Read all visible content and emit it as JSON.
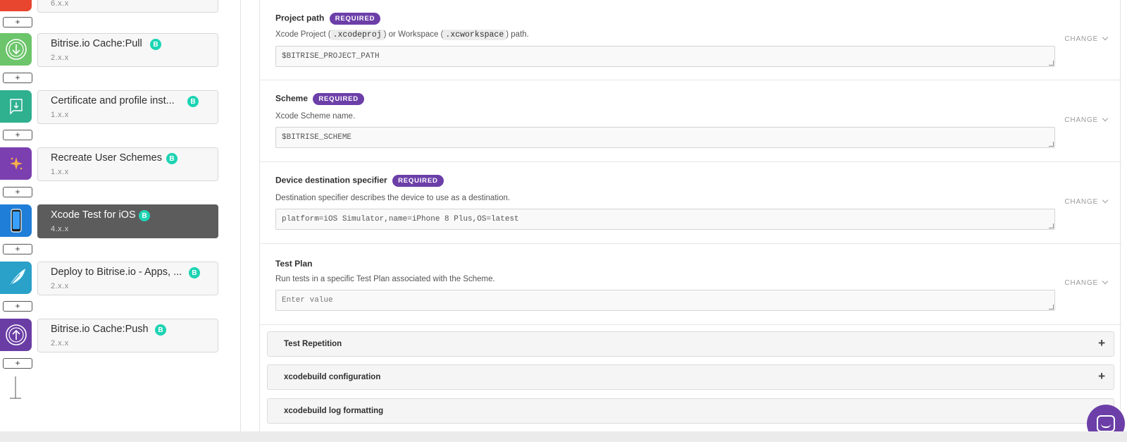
{
  "steps": [
    {
      "title": "Bitrise.io Cache:Pull",
      "version": "2.x.x",
      "icon": "download-circle-icon",
      "color": "#6cc56a"
    },
    {
      "title": "Certificate and profile inst...",
      "version": "1.x.x",
      "icon": "certificate-download-icon",
      "color": "#2fb08f"
    },
    {
      "title": "Recreate User Schemes",
      "version": "1.x.x",
      "icon": "sparkle-icon",
      "color": "#7b3fb0"
    },
    {
      "title": "Xcode Test for iOS",
      "version": "4.x.x",
      "icon": "iphone-icon",
      "color": "#1f7fd8"
    },
    {
      "title": "Deploy to Bitrise.io - Apps, ...",
      "version": "2.x.x",
      "icon": "feather-icon",
      "color": "#2aa1c9"
    },
    {
      "title": "Bitrise.io Cache:Push",
      "version": "2.x.x",
      "icon": "upload-circle-icon",
      "color": "#6a3da5"
    }
  ],
  "top_partial_step": {
    "version": "6.x.x",
    "icon_color": "#e8462e"
  },
  "badge_letter": "B",
  "plus_label": "+",
  "inputs": [
    {
      "title": "Project path",
      "required": "REQUIRED",
      "desc_pre": "Xcode Project (",
      "desc_code1": ".xcodeproj",
      "desc_mid": ") or Workspace (",
      "desc_code2": ".xcworkspace",
      "desc_post": ") path.",
      "value": "$BITRISE_PROJECT_PATH",
      "change": "CHANGE"
    },
    {
      "title": "Scheme",
      "required": "REQUIRED",
      "desc": "Xcode Scheme name.",
      "value": "$BITRISE_SCHEME",
      "change": "CHANGE"
    },
    {
      "title": "Device destination specifier",
      "required": "REQUIRED",
      "desc": "Destination specifier describes the device to use as a destination.",
      "value": "platform=iOS Simulator,name=iPhone 8 Plus,OS=latest",
      "change": "CHANGE"
    },
    {
      "title": "Test Plan",
      "desc": "Run tests in a specific Test Plan associated with the Scheme.",
      "placeholder": "Enter value",
      "change": "CHANGE"
    }
  ],
  "collapsibles": [
    {
      "label": "Test Repetition"
    },
    {
      "label": "xcodebuild configuration"
    },
    {
      "label": "xcodebuild log formatting"
    }
  ],
  "colors": {
    "accent": "#6c3fa8",
    "badge": "#1dd4b3",
    "selected": "#5c5c5c"
  }
}
